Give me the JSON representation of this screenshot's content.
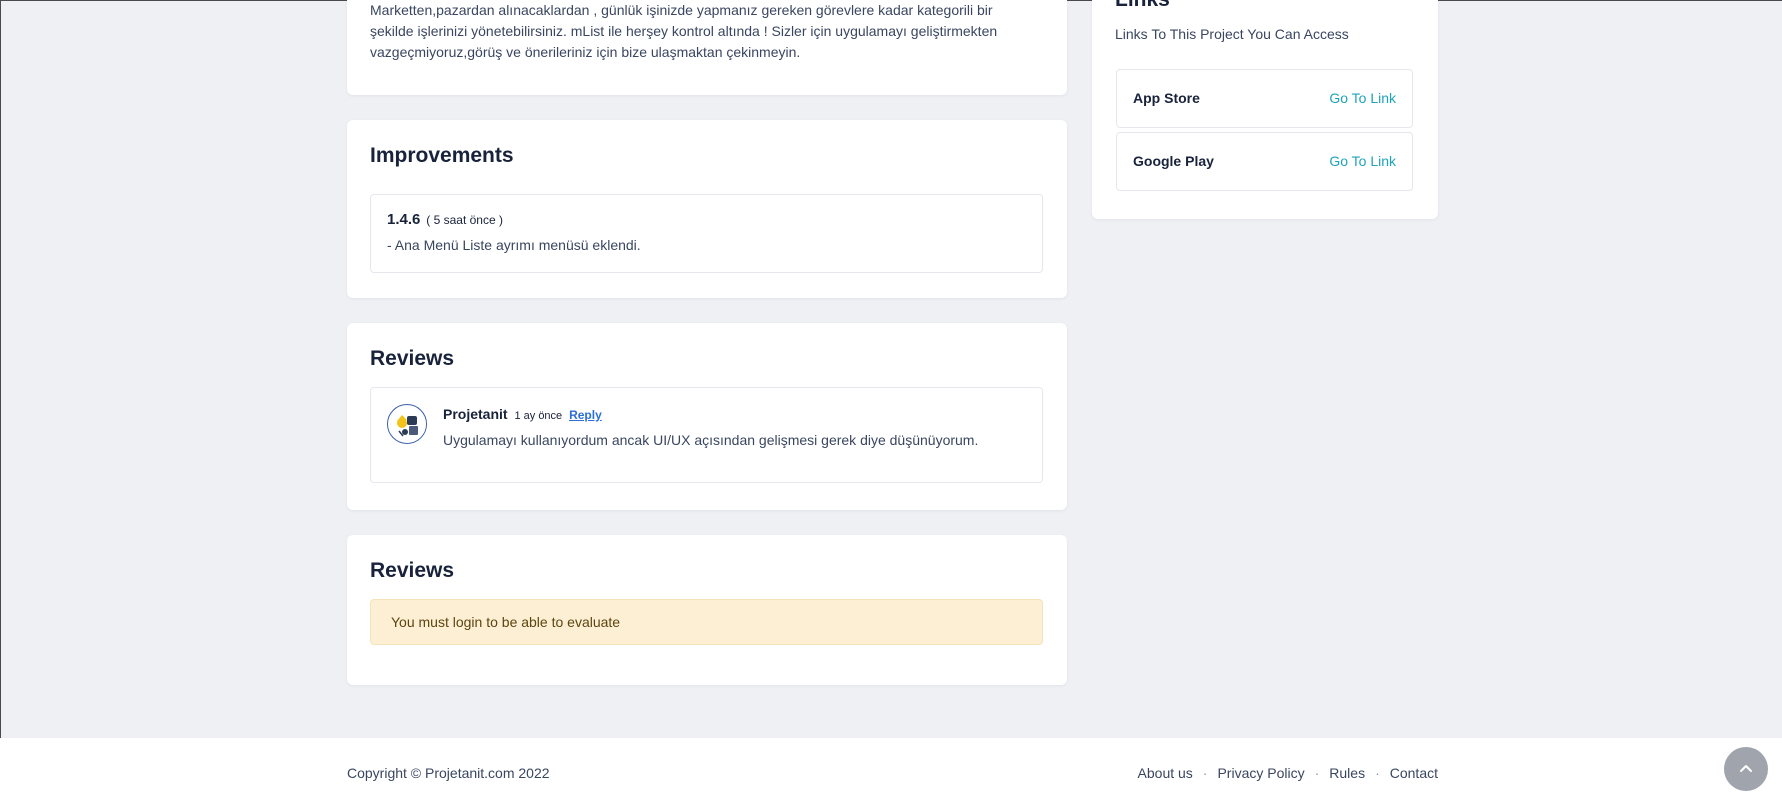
{
  "about": {
    "text": "Marketten,pazardan alınacaklardan , günlük işinizde yapmanız gereken görevlere kadar kategorili bir şekilde işlerinizi yönetebilirsiniz. mList ile herşey kontrol altında ! Sizler için uygulamayı geliştirmekten vazgeçmiyoruz,görüş ve önerileriniz için bize ulaşmaktan çekinmeyin."
  },
  "improvements": {
    "title": "Improvements",
    "items": [
      {
        "version": "1.4.6",
        "time": "( 5 saat önce )",
        "note": "- Ana Menü Liste ayrımı menüsü eklendi."
      }
    ]
  },
  "reviews": {
    "title": "Reviews",
    "items": [
      {
        "author": "Projetanit",
        "time": "1 ay önce",
        "reply_label": "Reply",
        "text": "Uygulamayı kullanıyordum ancak UI/UX açısından gelişmesi gerek diye düşünüyorum."
      }
    ]
  },
  "evaluate": {
    "title": "Reviews",
    "alert": "You must login to be able to evaluate"
  },
  "links": {
    "title": "Links",
    "subtitle": "Links To This Project You Can Access",
    "items": [
      {
        "name": "App Store",
        "action": "Go To Link"
      },
      {
        "name": "Google Play",
        "action": "Go To Link"
      }
    ]
  },
  "footer": {
    "copyright": "Copyright © Projetanit.com 2022",
    "nav": [
      "About us",
      "Privacy Policy",
      "Rules",
      "Contact"
    ],
    "separator": "·",
    "to_top_icon": "chevron-up-icon"
  }
}
